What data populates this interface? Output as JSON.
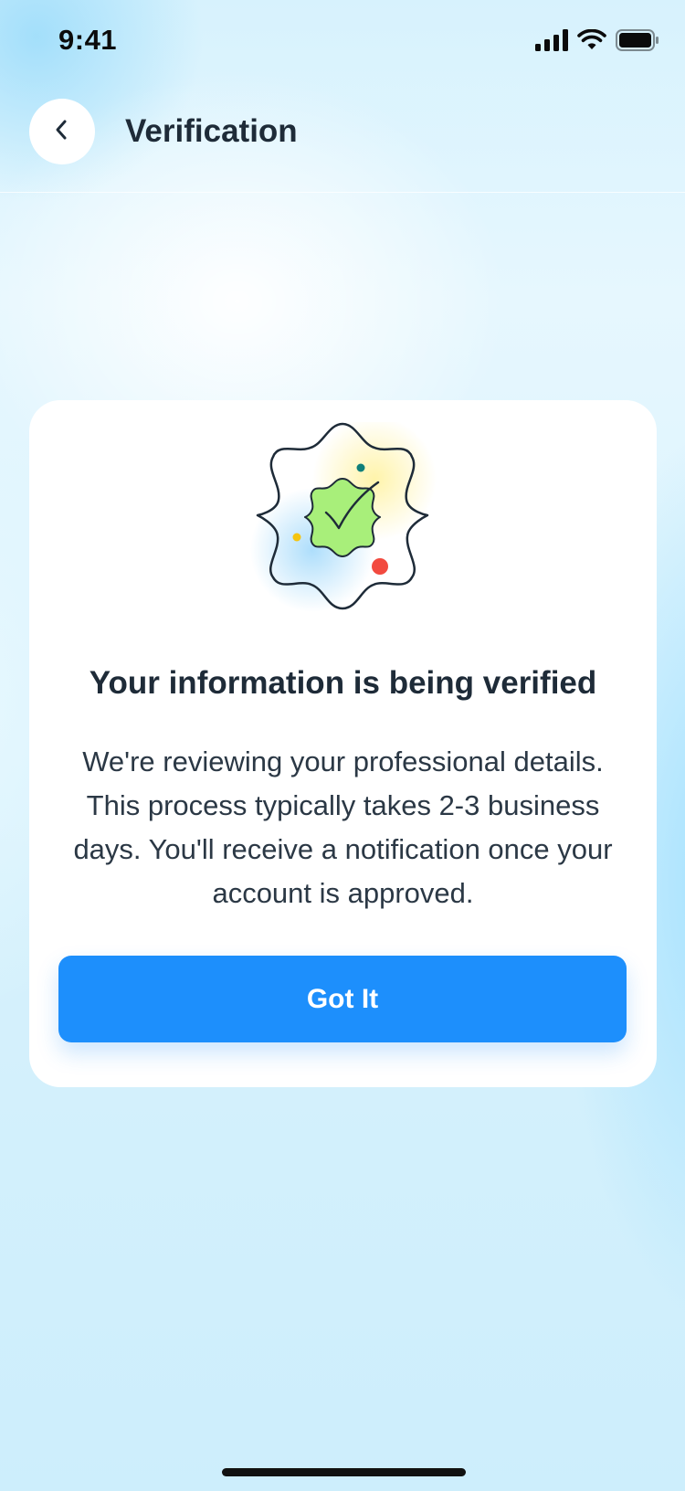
{
  "status_bar": {
    "time": "9:41",
    "icons": [
      "cellular-signal-icon",
      "wifi-icon",
      "battery-icon"
    ]
  },
  "header": {
    "title": "Verification",
    "back_icon": "chevron-left-icon"
  },
  "card": {
    "illustration_icon": "verified-badge-icon",
    "heading": "Your information is being verified",
    "body": "We're reviewing your professional details. This process typically takes 2-3 business days. You'll receive a notification once your account is approved.",
    "button_label": "Got It"
  },
  "colors": {
    "accent": "#1d8ffc",
    "badge_green": "#a8ef7a",
    "dot_red": "#f24a3f",
    "dot_yellow": "#f5c40f",
    "dot_teal": "#0f7f7a",
    "text_dark": "#1e2b38"
  }
}
